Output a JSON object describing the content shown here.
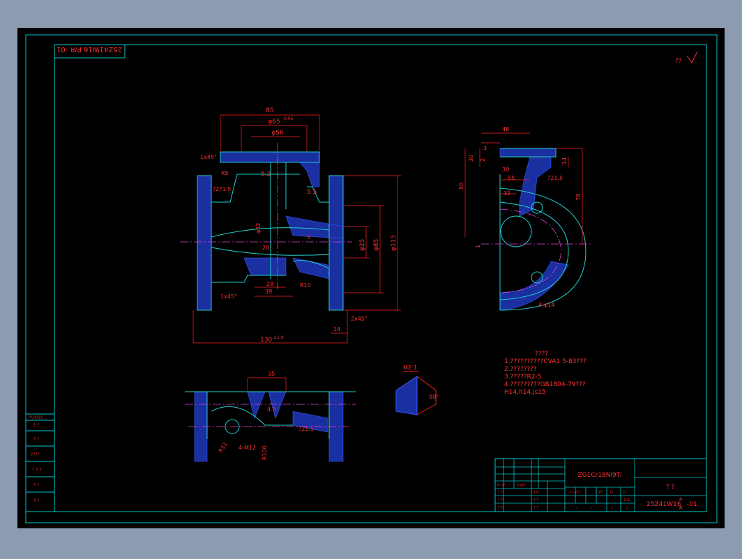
{
  "colors": {
    "background": "#8d9bb0",
    "sheet": "#000000",
    "frame": "#00c8c8",
    "dimension": "#ff2020",
    "outline": "#20d0d0",
    "hatch": "#3b5bff",
    "centerline": "#e040e0",
    "text": "#ff3030"
  },
  "drawing": {
    "corner_label": "25Z41W16 P/R -01",
    "roughness_symbol": "??"
  },
  "dims": {
    "d85": "85",
    "d65": "φ65",
    "d65_tol": "-0.05",
    "d56": "φ56",
    "d1x45": "1x45°",
    "d5": "R5",
    "d52": "5.2",
    "d55": "5.5",
    "d21": "?2?1.5",
    "d32": "φ32",
    "d20": "20",
    "d5b": "5",
    "d25": "φ25",
    "d85b": "φ85",
    "d115": "φ115",
    "d28": "28",
    "d39": "39",
    "r10": "R10",
    "d1x45b": "1x45°",
    "d14": "14",
    "d2x45": "2x45°",
    "d130": "130",
    "d130_tol": "±1.0",
    "s48": "48",
    "s3": "3",
    "s30": "30",
    "s2": "2",
    "s50": "50",
    "s55": "55",
    "s32": "32",
    "s21": "?21.5",
    "s78": "78",
    "s4d14": "4-φ14",
    "s14": "14",
    "s1": "1",
    "b35": "35",
    "b45": "4.5",
    "bm12": "4-M12",
    "br12": "R12",
    "br100": "R100",
    "b215": "?21.5",
    "detail_tag": "M2:1",
    "detail_90": "90°"
  },
  "notes": {
    "title": "????",
    "lines": [
      "1.??????????CVA1 5-83???",
      "2.????????",
      "3.?????R2-5",
      "4.?????????GB1804-79???",
      "   H14,h14,js15"
    ]
  },
  "title_block": {
    "material": "ZG1Cr18Ni9Ti",
    "part_name": "?     ?",
    "drawing_no": "25Z41W16",
    "drawing_no_sup": "P",
    "drawing_no_sub": "R",
    "drawing_no_suffix": "-01",
    "scale": "1:1",
    "small_cells": [
      "? ? ? ?",
      "??",
      "??",
      "??"
    ],
    "left_labels": [
      "?? ??",
      "?????",
      "? ?",
      "? ?",
      "? ?"
    ],
    "mid_labels": [
      "???",
      "? ?",
      "? ?",
      "? ?"
    ],
    "bottom_cells": [
      "?",
      "?",
      "?",
      "?"
    ]
  },
  "side_block": {
    "rows": [
      "??/????",
      "? ?",
      "? ?",
      "????",
      "? ? ?",
      "? ?",
      "? ?"
    ]
  }
}
